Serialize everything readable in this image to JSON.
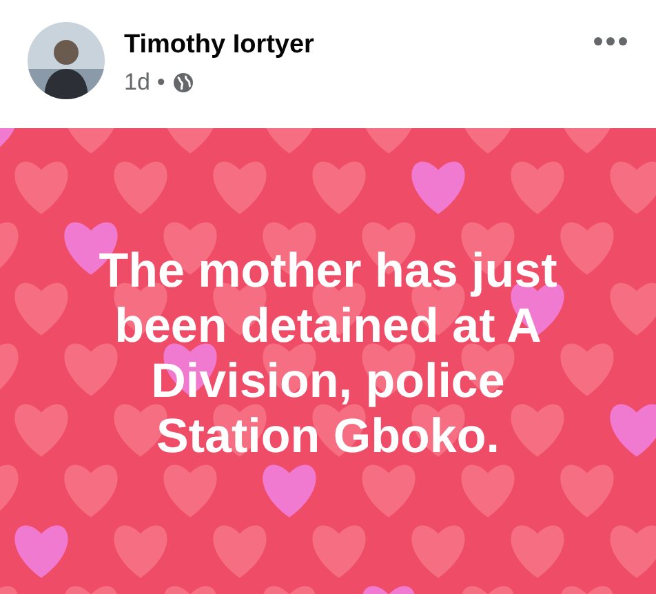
{
  "post": {
    "author": "Timothy Iortyer",
    "time": "1d",
    "separator": "•",
    "text": "The mother has just been detained at A Division, police Station Gboko."
  }
}
